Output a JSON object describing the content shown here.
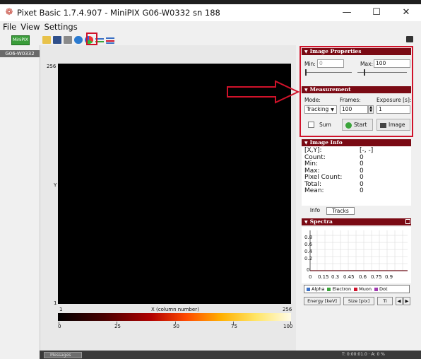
{
  "window": {
    "title": "Pixet Basic 1.7.4.907 - MiniPIX G06-W0332 sn 188",
    "minimize": "—",
    "maximize": "☐",
    "close": "✕"
  },
  "menu": {
    "items": [
      "File",
      "View",
      "Settings"
    ]
  },
  "device": {
    "icon_text": "MiniPIX",
    "label": "G06-W0332"
  },
  "plot": {
    "y_top": "256",
    "y_bottom": "1",
    "y_label": "Y",
    "x_left": "1",
    "x_right": "256",
    "x_label": "X (column number)",
    "colorbar_ticks": [
      "0",
      "25",
      "50",
      "75",
      "100"
    ]
  },
  "image_properties": {
    "header": "Image Properties",
    "min_label": "Min:",
    "min_value": "0",
    "max_label": "Max:",
    "max_value": "100"
  },
  "measurement": {
    "header": "Measurement",
    "mode_label": "Mode:",
    "frames_label": "Frames:",
    "exposure_label": "Exposure [s]:",
    "mode_value": "Tracking",
    "frames_value": "100",
    "exposure_value": "1",
    "sum_label": "Sum",
    "start_label": "Start",
    "image_label": "Image"
  },
  "image_info": {
    "header": "Image Info",
    "rows": [
      {
        "k": "[X,Y]:",
        "v": "[-, -]"
      },
      {
        "k": "Count:",
        "v": "0"
      },
      {
        "k": "Min:",
        "v": "0"
      },
      {
        "k": "Max:",
        "v": "0"
      },
      {
        "k": "Pixel Count:",
        "v": "0"
      },
      {
        "k": "Total:",
        "v": "0"
      },
      {
        "k": "Mean:",
        "v": "0"
      }
    ],
    "tabs": [
      "Info",
      "Tracks"
    ]
  },
  "spectra": {
    "header": "Spectra",
    "y_ticks": [
      "0.8",
      "0.6",
      "0.4",
      "0.2",
      "0"
    ],
    "x_ticks": [
      "0",
      "0.15",
      "0.3",
      "0.45",
      "0.6",
      "0.75",
      "0.9"
    ],
    "legend": [
      {
        "name": "Alpha",
        "color": "#3a6fc4"
      },
      {
        "name": "Electron",
        "color": "#3aa43a"
      },
      {
        "name": "Muon",
        "color": "#d0122a"
      },
      {
        "name": "Dot",
        "color": "#a03ab0"
      }
    ],
    "tabs": [
      "Energy [keV]",
      "Size [pix]",
      "Ti"
    ]
  },
  "status": {
    "messages_label": "Messages",
    "stat_text": "T: 0:00:01.0 · A: 0 %"
  },
  "colors": {
    "header_bg": "#7a0a14",
    "highlight": "#d0122a"
  }
}
